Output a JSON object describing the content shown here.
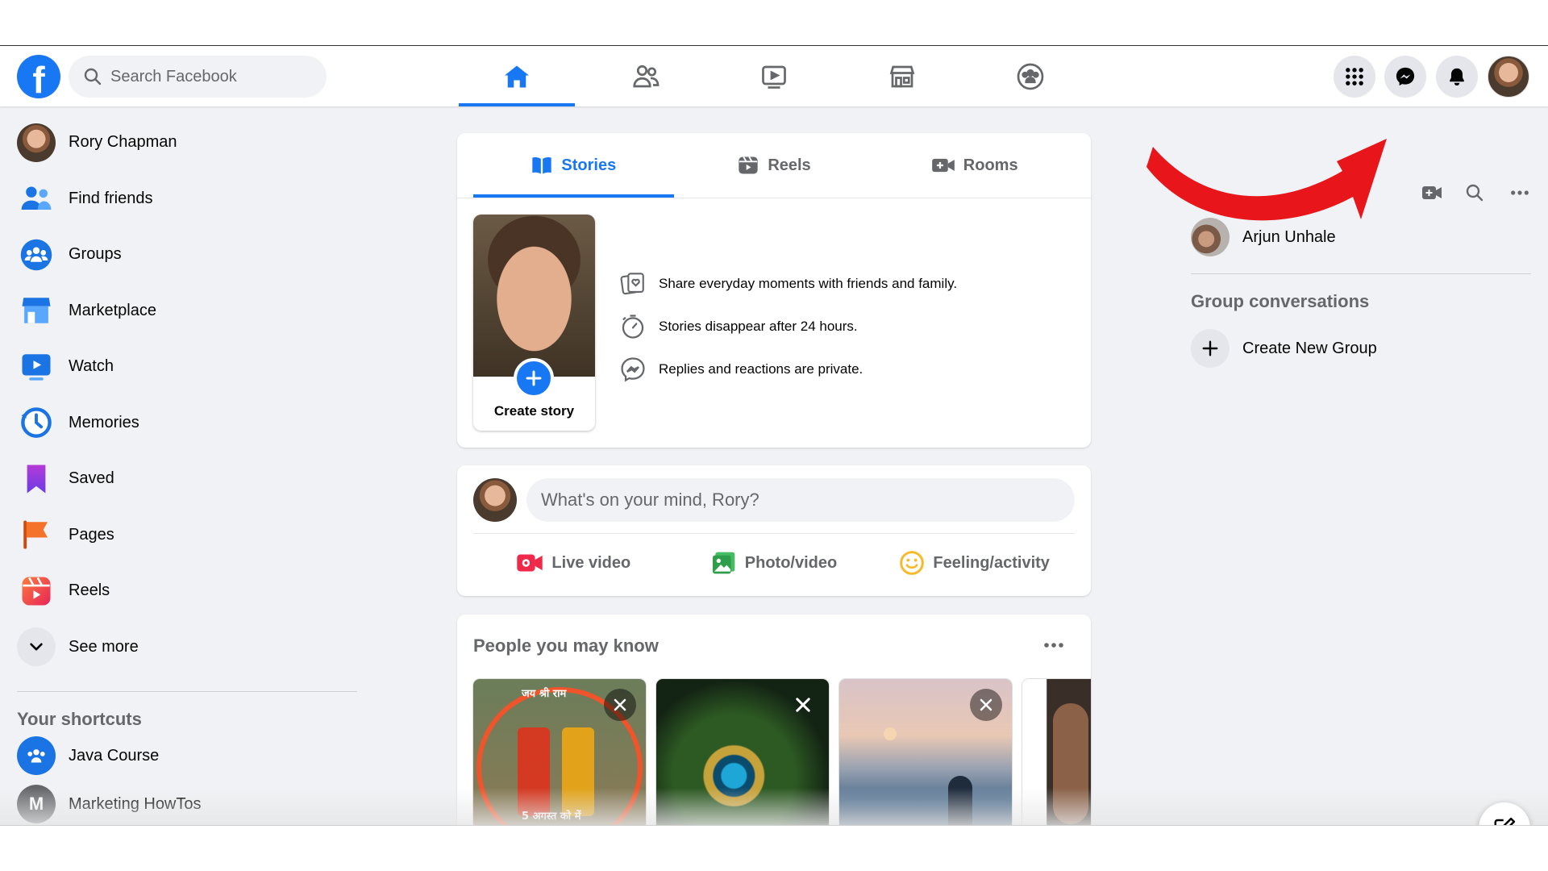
{
  "header": {
    "logo_letter": "f",
    "search_placeholder": "Search Facebook",
    "nav_tabs": [
      {
        "name": "home",
        "icon": "home-icon",
        "active": true
      },
      {
        "name": "friends",
        "icon": "friends-icon",
        "active": false
      },
      {
        "name": "watch",
        "icon": "video-icon",
        "active": false
      },
      {
        "name": "marketplace",
        "icon": "marketplace-icon",
        "active": false
      },
      {
        "name": "groups",
        "icon": "groups-icon",
        "active": false
      }
    ],
    "right_buttons": [
      "menu-grid-icon",
      "messenger-icon",
      "notifications-bell-icon",
      "profile-avatar"
    ]
  },
  "sidebar": {
    "items": [
      {
        "label": "Rory Chapman",
        "icon": "profile-avatar"
      },
      {
        "label": "Find friends",
        "icon": "friends-icon"
      },
      {
        "label": "Groups",
        "icon": "groups-icon"
      },
      {
        "label": "Marketplace",
        "icon": "marketplace-icon"
      },
      {
        "label": "Watch",
        "icon": "watch-icon"
      },
      {
        "label": "Memories",
        "icon": "memories-clock-icon"
      },
      {
        "label": "Saved",
        "icon": "saved-bookmark-icon"
      },
      {
        "label": "Pages",
        "icon": "pages-flag-icon"
      },
      {
        "label": "Reels",
        "icon": "reels-icon"
      },
      {
        "label": "See more",
        "icon": "chevron-down-icon"
      }
    ],
    "shortcuts_title": "Your shortcuts",
    "shortcuts": [
      {
        "label": "Java Course",
        "icon": "groups-icon"
      },
      {
        "label": "Marketing HowTos",
        "icon": "letter-avatar",
        "letter": "M"
      }
    ]
  },
  "stories": {
    "tabs": [
      {
        "label": "Stories",
        "icon": "book-open-icon",
        "active": true
      },
      {
        "label": "Reels",
        "icon": "reels-icon",
        "active": false
      },
      {
        "label": "Rooms",
        "icon": "video-plus-icon",
        "active": false
      }
    ],
    "create_story_label": "Create story",
    "info": [
      {
        "text": "Share everyday moments with friends and family.",
        "icon": "photo-heart-icon"
      },
      {
        "text": "Stories disappear after 24 hours.",
        "icon": "timer-icon"
      },
      {
        "text": "Replies and reactions are private.",
        "icon": "messenger-icon"
      }
    ]
  },
  "composer": {
    "placeholder": "What's on your mind, Rory?",
    "actions": [
      {
        "label": "Live video",
        "icon": "live-video-icon",
        "color": "#f02849"
      },
      {
        "label": "Photo/video",
        "icon": "photo-icon",
        "color": "#45bd62"
      },
      {
        "label": "Feeling/activity",
        "icon": "smile-icon",
        "color": "#f7b928"
      }
    ]
  },
  "pymk": {
    "title": "People you may know",
    "cards_text": {
      "card1_top": "जय श्री राम",
      "card1_bottom": "5 अगस्त को में"
    }
  },
  "right_rail": {
    "contacts": [
      {
        "name": "Arjun Unhale"
      }
    ],
    "group_conversations_title": "Group conversations",
    "create_group_label": "Create New Group"
  },
  "colors": {
    "accent": "#1877f2",
    "background": "#f0f2f5",
    "annotation_arrow": "#e8151b"
  }
}
